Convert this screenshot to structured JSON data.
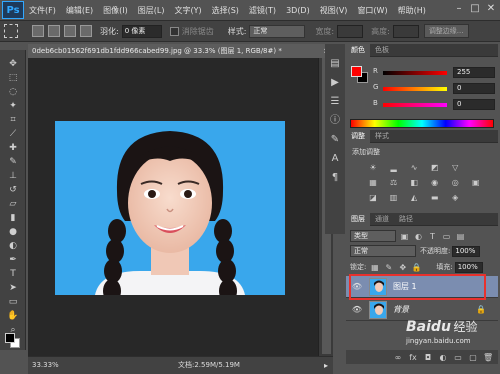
{
  "app": {
    "logo": "Ps"
  },
  "menu": [
    "文件(F)",
    "编辑(E)",
    "图像(I)",
    "图层(L)",
    "文字(Y)",
    "选择(S)",
    "滤镜(T)",
    "3D(D)",
    "视图(V)",
    "窗口(W)",
    "帮助(H)"
  ],
  "options": {
    "feather_label": "羽化:",
    "feather_value": "0 像素",
    "antialias_label": "消除锯齿",
    "style_label": "样式:",
    "style_value": "正常",
    "width_label": "宽度:",
    "height_label": "高度:",
    "refine_button": "调整边缘..."
  },
  "document": {
    "tab_title": "0deb6cb01562f691db1fdd966cabed99.jpg @ 33.3% (图层 1, RGB/8#) *",
    "close": "×",
    "zoom": "33.33%",
    "doc_size": "文档:2.59M/5.19M"
  },
  "color_panel": {
    "tabs": [
      "颜色",
      "色板"
    ],
    "r_label": "R",
    "r_value": "255",
    "g_label": "G",
    "g_value": "0",
    "b_label": "B",
    "b_value": "0",
    "fg_color": "#ff0000",
    "bg_color": "#000000"
  },
  "adjust_panel": {
    "tabs": [
      "调整",
      "样式"
    ],
    "title": "添加调整"
  },
  "layers_panel": {
    "tabs": [
      "图层",
      "通道",
      "路径"
    ],
    "filter_kind": "类型",
    "blend_mode": "正常",
    "opacity_label": "不透明度:",
    "opacity_value": "100%",
    "lock_label": "锁定:",
    "fill_label": "填充:",
    "fill_value": "100%",
    "layers": [
      {
        "name": "图层 1",
        "selected": true
      },
      {
        "name": "背景",
        "selected": false
      }
    ],
    "highlight_color": "#e8312d"
  },
  "watermark": {
    "logo": "Baidu",
    "text": "经验",
    "url": "jingyan.baidu.com"
  }
}
